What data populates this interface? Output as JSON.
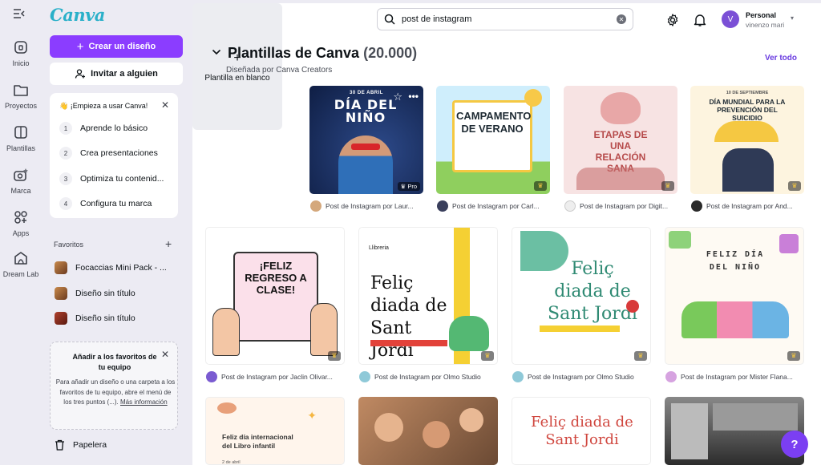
{
  "brand": "Canva",
  "rail": [
    {
      "label": "Inicio",
      "icon": "home-icon"
    },
    {
      "label": "Proyectos",
      "icon": "folder-icon"
    },
    {
      "label": "Plantillas",
      "icon": "templates-icon"
    },
    {
      "label": "Marca",
      "icon": "brand-icon"
    },
    {
      "label": "Apps",
      "icon": "apps-icon"
    },
    {
      "label": "Dream Lab",
      "icon": "dreamlab-icon"
    }
  ],
  "panel": {
    "create_label": "Crear un diseño",
    "invite_label": "Invitar a alguien",
    "onboarding_title": "👋 ¡Empieza a usar Canva!",
    "steps": [
      {
        "num": "1",
        "label": "Aprende lo básico"
      },
      {
        "num": "2",
        "label": "Crea presentaciones"
      },
      {
        "num": "3",
        "label": "Optimiza tu contenid..."
      },
      {
        "num": "4",
        "label": "Configura tu marca"
      }
    ],
    "favorites_heading": "Favoritos",
    "favorites": [
      "Focaccias Mini Pack - ...",
      "Diseño sin título",
      "Diseño sin título"
    ],
    "team_title": "Añadir a los favoritos de tu equipo",
    "team_body": "Para añadir un diseño o una carpeta a los favoritos de tu equipo, abre el menú de los tres puntos (...).",
    "team_link": "Más información",
    "trash_label": "Papelera"
  },
  "header": {
    "search_value": "post de instagram",
    "account_name": "Personal",
    "account_user": "vinenzo mari",
    "avatar_letter": "V"
  },
  "section": {
    "title": "Plantillas de Canva",
    "count": "(20.000)",
    "subtitle": "Diseñada por Canva Creators",
    "see_all": "Ver todo",
    "blank_label": "Plantilla en blanco"
  },
  "templates_row1": [
    {
      "caption": "Post de Instagram por Laur...",
      "badge": "Pro",
      "text": "DÍA DEL NIÑO",
      "top": "30 DE ABRIL"
    },
    {
      "caption": "Post de Instagram por Carl...",
      "text": "CAMPAMENTO DE VERANO"
    },
    {
      "caption": "Post de Instagram por Digit...",
      "text": "ETAPAS DE UNA RELACIÓN SANA"
    },
    {
      "caption": "Post de Instagram por And...",
      "text": "DÍA MUNDIAL PARA LA PREVENCIÓN DEL SUICIDIO",
      "top": "10 DE SEPTIEMBRE"
    }
  ],
  "templates_row2": [
    {
      "caption": "Post de Instagram por Jaclin Olivar...",
      "text": "¡FELIZ REGRESO A CLASE!"
    },
    {
      "caption": "Post de Instagram por Olmo Studio",
      "text": "Feliç diada de Sant Jordi",
      "top": "Llibreria"
    },
    {
      "caption": "Post de Instagram por Olmo Studio",
      "text": "Feliç diada de Sant Jordi"
    },
    {
      "caption": "Post de Instagram por Mister Flana...",
      "text": "FELIZ DÍA DEL NIÑO"
    }
  ],
  "templates_row3": [
    {
      "text": "Feliz día internacional del Libro infantil",
      "top": "2 de abril"
    },
    {
      "text": ""
    },
    {
      "text": "Feliç diada de Sant Jordi"
    },
    {
      "text": ""
    }
  ],
  "help_label": "?",
  "colors": {
    "accent": "#8b3dff",
    "bg": "#ecebf3",
    "link": "#6a3ce0"
  }
}
